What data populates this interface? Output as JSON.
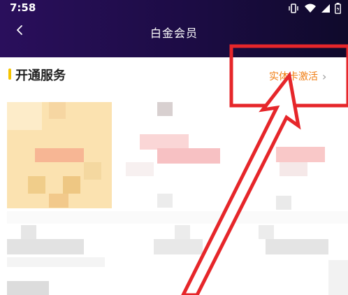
{
  "status_bar": {
    "time": "7:58"
  },
  "nav": {
    "title": "白金会员"
  },
  "section": {
    "title": "开通服务",
    "activate_label": "实体卡激活"
  },
  "colors": {
    "accent": "#f5c400",
    "link": "#f07d12",
    "annotation": "#e6262a"
  },
  "icons": [
    "back-arrow-icon",
    "vibrate-icon",
    "wifi-icon",
    "signal-icon",
    "battery-icon",
    "chevron-right-icon"
  ]
}
